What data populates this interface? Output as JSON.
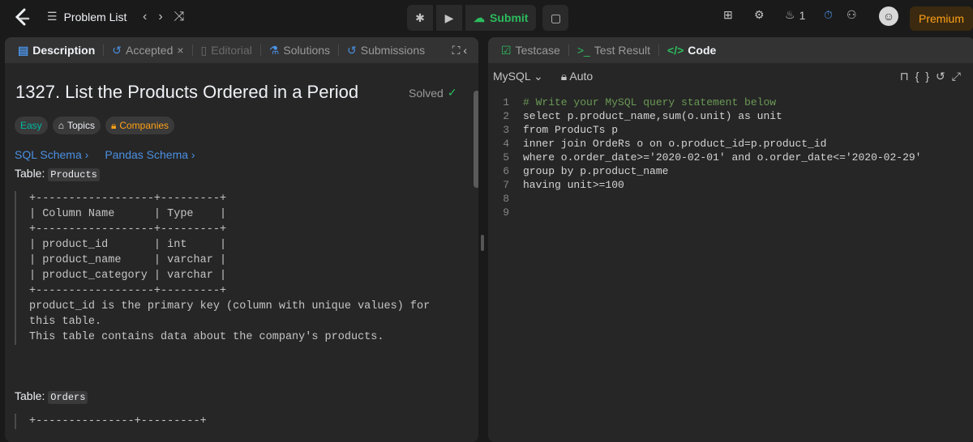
{
  "topbar": {
    "problem_list": "Problem List",
    "submit": "Submit",
    "streak": "1",
    "premium": "Premium"
  },
  "left": {
    "tabs": [
      "Description",
      "Accepted",
      "Editorial",
      "Solutions",
      "Submissions"
    ],
    "title": "1327. List the Products Ordered in a Period",
    "solved": "Solved",
    "chips": [
      "Easy",
      "Topics",
      "Companies"
    ],
    "links": [
      "SQL Schema",
      "Pandas Schema"
    ],
    "table_prefix": "Table:",
    "table1": "Products",
    "table2": "Orders",
    "ascii_table": "+------------------+---------+\n| Column Name      | Type    |\n+------------------+---------+\n| product_id       | int     |\n| product_name     | varchar |\n| product_category | varchar |\n+------------------+---------+\nproduct_id is the primary key (column with unique values) for\nthis table.\nThis table contains data about the company's products.",
    "ascii_table2": "+---------------+---------+"
  },
  "right": {
    "tabs": [
      "Testcase",
      "Test Result",
      "Code"
    ],
    "language": "MySQL",
    "mode": "Auto",
    "lines": [
      "1",
      "2",
      "3",
      "4",
      "5",
      "6",
      "7",
      "8",
      "9"
    ],
    "code": [
      "# Write your MySQL query statement below",
      "select p.product_name,sum(o.unit) as unit",
      "from ProducTs p",
      "inner join OrdeRs o on o.product_id=p.product_id",
      "where o.order_date>='2020-02-01' and o.order_date<='2020-02-29'",
      "group by p.product_name",
      "having unit>=100",
      "",
      ""
    ]
  },
  "colors": {
    "accent": "#ffa116",
    "green": "#2cbb5d",
    "link": "#4a90e2"
  }
}
